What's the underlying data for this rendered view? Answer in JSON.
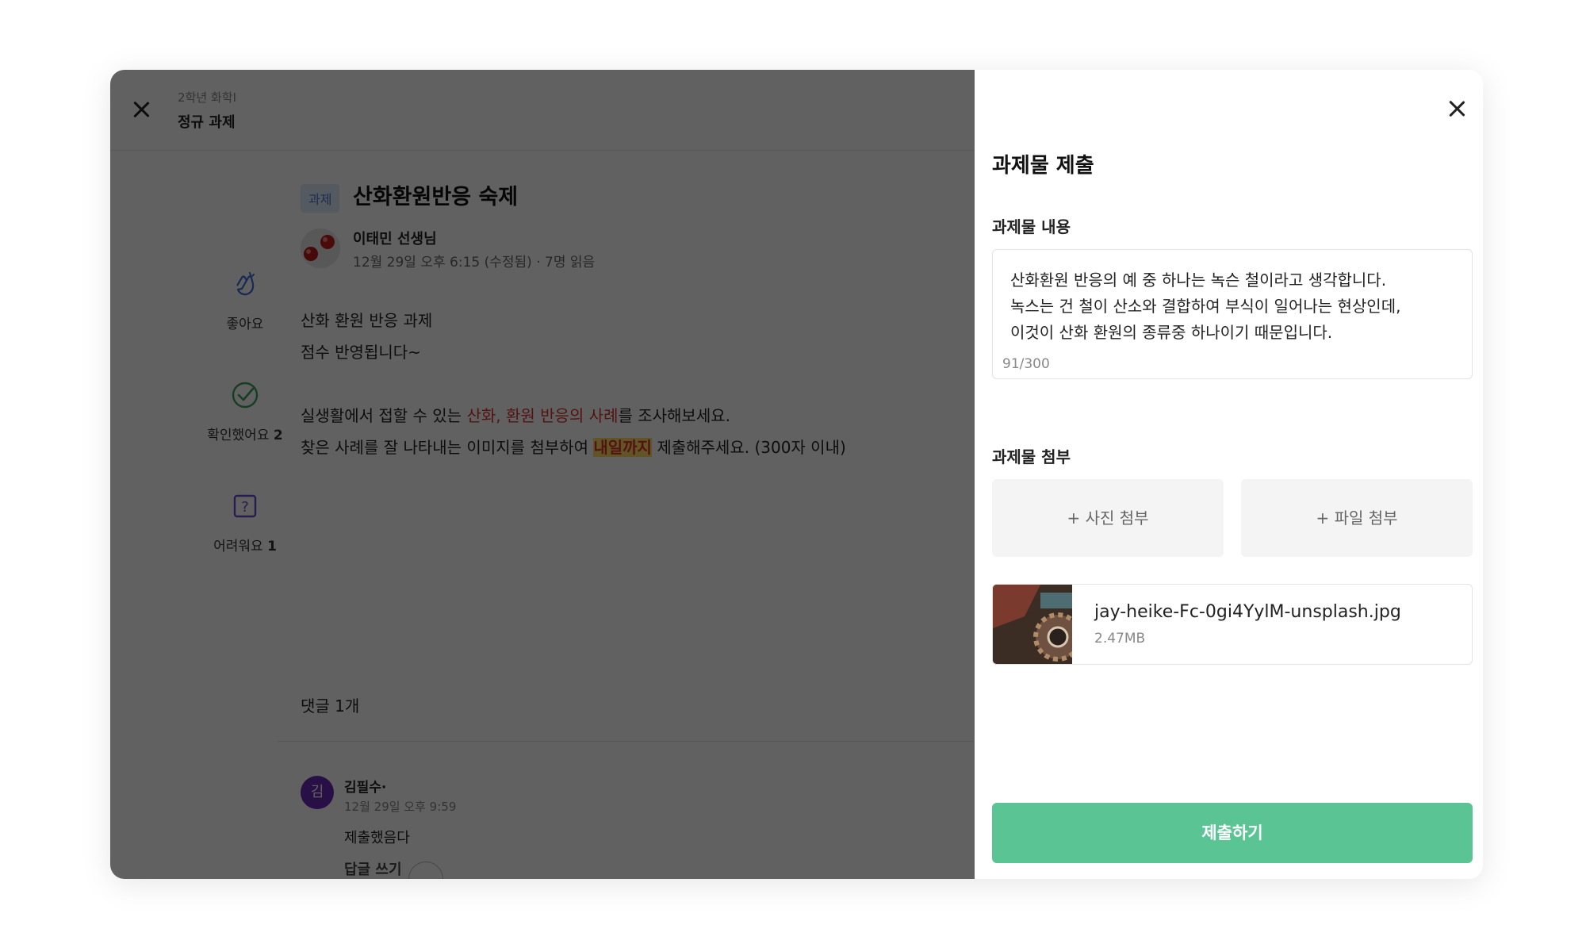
{
  "header": {
    "subtitle": "2학년 화학I",
    "title": "정규 과제"
  },
  "reactions": [
    {
      "label": "좋아요",
      "count": ""
    },
    {
      "label": "확인했어요",
      "count": "2"
    },
    {
      "label": "어려워요",
      "count": "1"
    }
  ],
  "post": {
    "tag": "과제",
    "title": "산화환원반응 숙제",
    "author": "이태민 선생님",
    "meta": "12월 29일 오후 6:15 (수정됨) · 7명 읽음",
    "line1": "산화 환원 반응 과제",
    "line2": "점수 반영됩니다~",
    "line3_a": "실생활에서 접할 수 있는 ",
    "line3_red": "산화, 환원 반응의 사례",
    "line3_b": "를 조사해보세요.",
    "line4_a": "찾은 사례를 잘 나타내는 이미지를 첨부하여 ",
    "line4_hl": "내일까지",
    "line4_b": " 제출해주세요. (300자 이내)"
  },
  "comments": {
    "count_label": "댓글 1개",
    "items": [
      {
        "avatar": "김",
        "name": "김필수·",
        "time": "12월 29일 오후 9:59",
        "text": "제출했음다",
        "reply_label": "답글 쓰기"
      }
    ]
  },
  "panel": {
    "title": "과제물 제출",
    "content_label": "과제물 내용",
    "content_text": "산화환원 반응의 예 중 하나는 녹슨 철이라고 생각합니다.\n녹스는 건 철이 산소와 결합하여 부식이 일어나는 현상인데,\n이것이 산화 환원의 종류중 하나이기 때문입니다.",
    "char_count": "91/300",
    "attach_label": "과제물 첨부",
    "photo_button": "+ 사진 첨부",
    "file_button": "+ 파일 첨부",
    "file": {
      "name": "jay-heike-Fc-0gi4YylM-unsplash.jpg",
      "size": "2.47MB"
    },
    "submit_label": "제출하기"
  },
  "colors": {
    "accent": "#5ac495",
    "tag_bg": "#dfe9fb",
    "tag_text": "#4a78d6",
    "highlight": "#ffe066",
    "emphasis": "#d9342b"
  }
}
